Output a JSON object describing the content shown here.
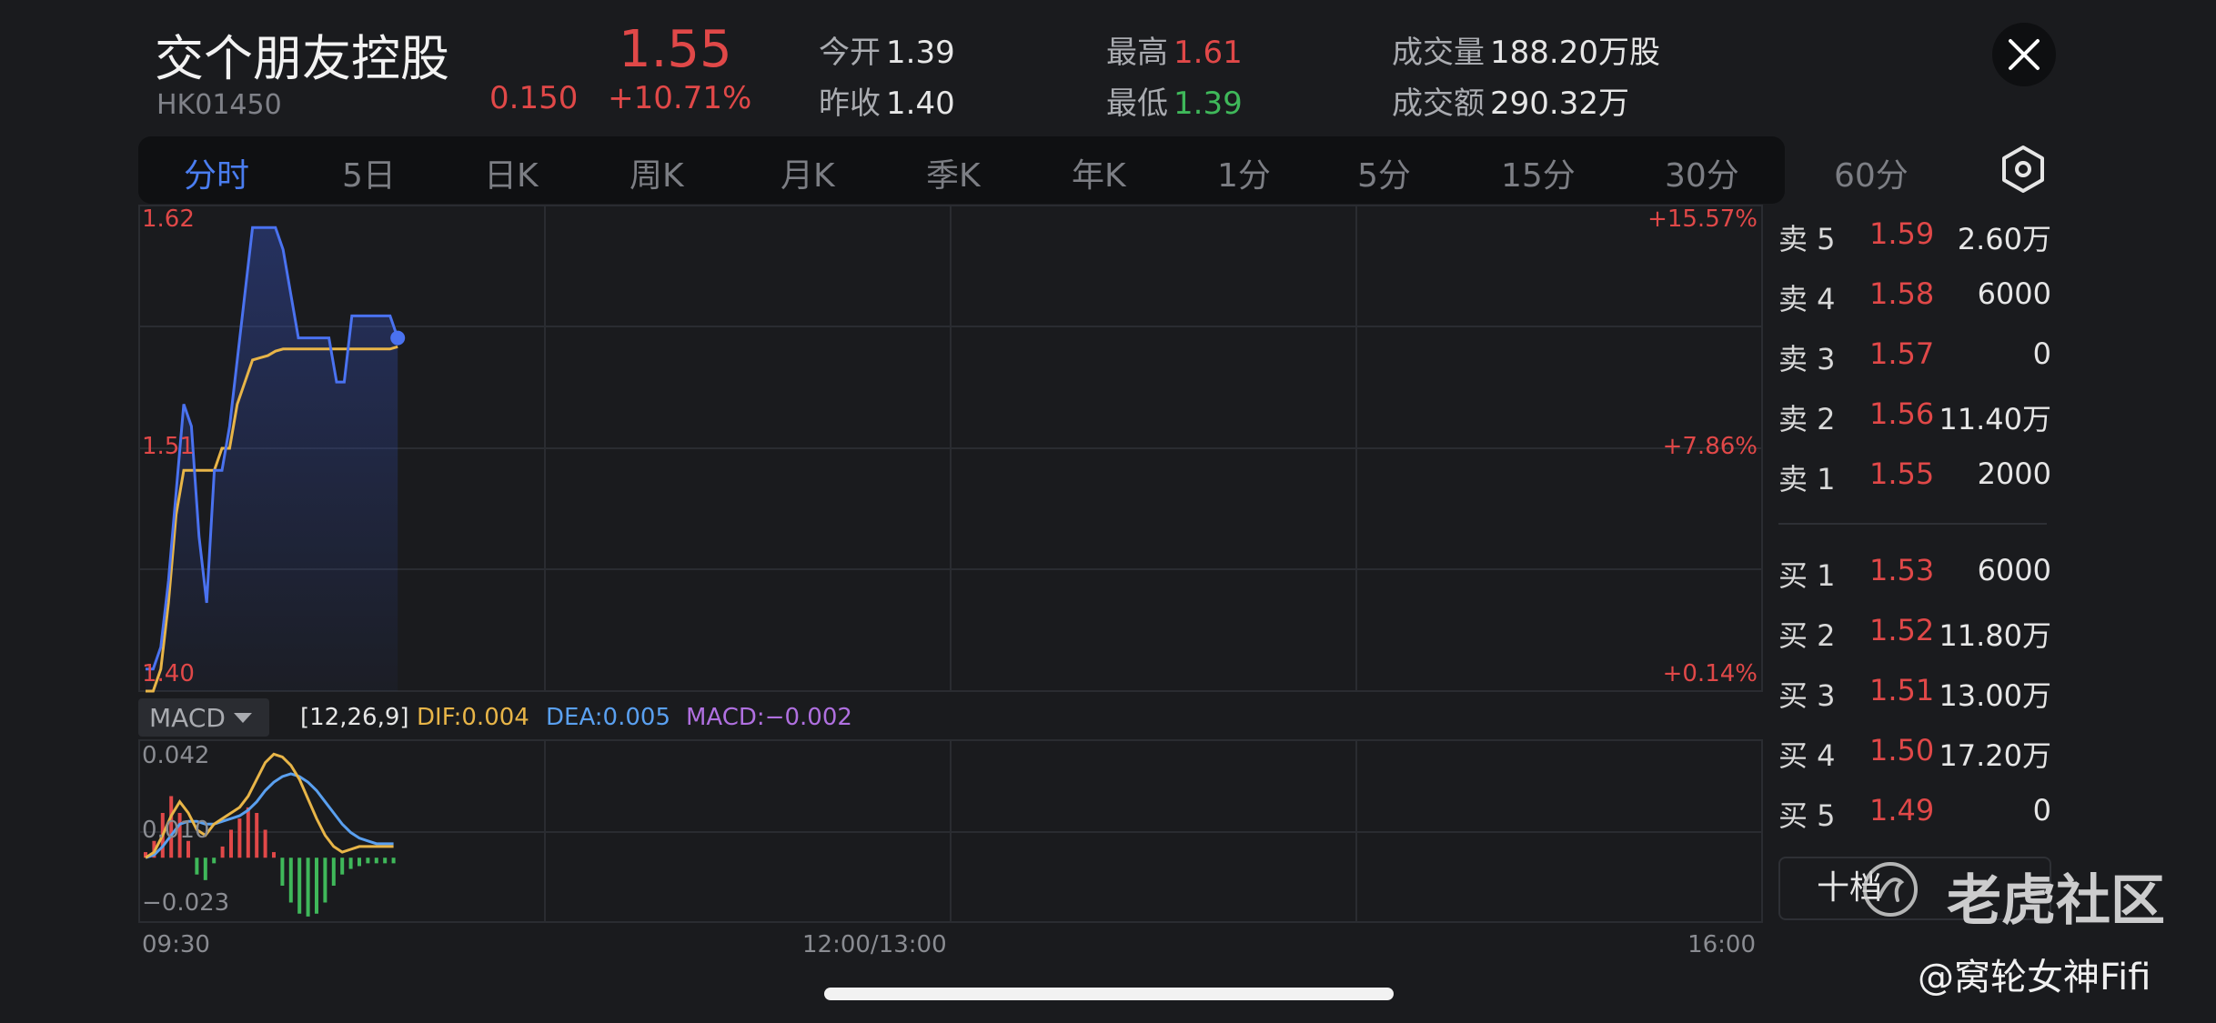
{
  "header": {
    "name": "交个朋友控股",
    "code": "HK01450",
    "price": "1.55",
    "change": "0.150",
    "change_pct": "+10.71%",
    "open_label": "今开",
    "open": "1.39",
    "prev_close_label": "昨收",
    "prev_close": "1.40",
    "high_label": "最高",
    "high": "1.61",
    "low_label": "最低",
    "low": "1.39",
    "volume_label": "成交量",
    "volume": "188.20万股",
    "turnover_label": "成交额",
    "turnover": "290.32万"
  },
  "tabs": [
    "分时",
    "5日",
    "日K",
    "周K",
    "月K",
    "季K",
    "年K",
    "1分",
    "5分",
    "15分",
    "30分",
    "60分"
  ],
  "active_tab": "分时",
  "icons": {
    "close": "close-icon",
    "settings": "hexagon-settings-icon",
    "dropdown": "caret-down-icon",
    "watermark": "tiger-logo-icon"
  },
  "colors": {
    "up": "#e04848",
    "down": "#3fb85a",
    "price_line": "#4a72f0",
    "avg_line": "#e8b548",
    "dif": "#e8b548",
    "dea": "#5aa0f0",
    "macd": "#b070e0"
  },
  "price_axis": {
    "top": "1.62",
    "mid": "1.51",
    "bottom": "1.40",
    "pct_top": "+15.57%",
    "pct_mid": "+7.86%",
    "pct_bottom": "+0.14%"
  },
  "time_axis": {
    "start": "09:30",
    "mid": "12:00/13:00",
    "end": "16:00"
  },
  "macd": {
    "indicator": "MACD",
    "params": "[12,26,9]",
    "dif_label": "DIF:",
    "dif": "0.004",
    "dea_label": "DEA:",
    "dea": "0.005",
    "macd_label": "MACD:",
    "macd": "−0.002",
    "axis_top": "0.042",
    "axis_mid": "0.010",
    "axis_bottom": "−0.023"
  },
  "order_book": {
    "asks": [
      {
        "label": "卖 5",
        "price": "1.59",
        "volume": "2.60万"
      },
      {
        "label": "卖 4",
        "price": "1.58",
        "volume": "6000"
      },
      {
        "label": "卖 3",
        "price": "1.57",
        "volume": "0"
      },
      {
        "label": "卖 2",
        "price": "1.56",
        "volume": "11.40万"
      },
      {
        "label": "卖 1",
        "price": "1.55",
        "volume": "2000"
      }
    ],
    "bids": [
      {
        "label": "买 1",
        "price": "1.53",
        "volume": "6000"
      },
      {
        "label": "买 2",
        "price": "1.52",
        "volume": "11.80万"
      },
      {
        "label": "买 3",
        "price": "1.51",
        "volume": "13.00万"
      },
      {
        "label": "买 4",
        "price": "1.50",
        "volume": "17.20万"
      },
      {
        "label": "买 5",
        "price": "1.49",
        "volume": "0"
      }
    ],
    "depth_button": "十档"
  },
  "watermark": {
    "brand": "老虎社区",
    "handle": "@窝轮女神Fifi"
  },
  "chart_data": {
    "type": "line",
    "x_start": "09:30",
    "x_end": "16:00",
    "ylim": [
      1.4,
      1.62
    ],
    "series": [],
    "price": [
      1.41,
      1.41,
      1.42,
      1.45,
      1.49,
      1.53,
      1.52,
      1.47,
      1.44,
      1.5,
      1.5,
      1.52,
      1.55,
      1.58,
      1.61,
      1.61,
      1.61,
      1.61,
      1.6,
      1.58,
      1.56,
      1.56,
      1.56,
      1.56,
      1.56,
      1.54,
      1.54,
      1.57,
      1.57,
      1.57,
      1.57,
      1.57,
      1.57,
      1.56
    ],
    "avg": [
      1.4,
      1.4,
      1.41,
      1.44,
      1.48,
      1.5,
      1.5,
      1.5,
      1.5,
      1.5,
      1.51,
      1.51,
      1.53,
      1.54,
      1.55,
      1.551,
      1.552,
      1.554,
      1.555,
      1.555,
      1.555,
      1.555,
      1.555,
      1.555,
      1.555,
      1.555,
      1.555,
      1.555,
      1.555,
      1.555,
      1.555,
      1.555,
      1.555,
      1.556
    ],
    "macd_ylim": [
      -0.023,
      0.042
    ],
    "macd_dif": [
      0.0,
      0.002,
      0.008,
      0.015,
      0.02,
      0.016,
      0.01,
      0.008,
      0.012,
      0.014,
      0.016,
      0.018,
      0.022,
      0.028,
      0.034,
      0.037,
      0.036,
      0.033,
      0.028,
      0.021,
      0.014,
      0.008,
      0.004,
      0.002,
      0.003,
      0.004,
      0.004,
      0.004,
      0.004,
      0.004
    ],
    "macd_dea": [
      0.0,
      0.001,
      0.004,
      0.008,
      0.012,
      0.013,
      0.013,
      0.012,
      0.012,
      0.013,
      0.014,
      0.015,
      0.017,
      0.02,
      0.024,
      0.027,
      0.029,
      0.03,
      0.029,
      0.027,
      0.024,
      0.02,
      0.016,
      0.012,
      0.009,
      0.007,
      0.006,
      0.005,
      0.005,
      0.005
    ],
    "macd_hist": [
      0.002,
      0.006,
      0.016,
      0.022,
      0.016,
      0.006,
      -0.006,
      -0.008,
      -0.002,
      0.004,
      0.01,
      0.014,
      0.018,
      0.016,
      0.01,
      0.002,
      -0.01,
      -0.016,
      -0.02,
      -0.021,
      -0.02,
      -0.016,
      -0.01,
      -0.006,
      -0.004,
      -0.003,
      -0.002,
      -0.002,
      -0.002,
      -0.002
    ]
  }
}
